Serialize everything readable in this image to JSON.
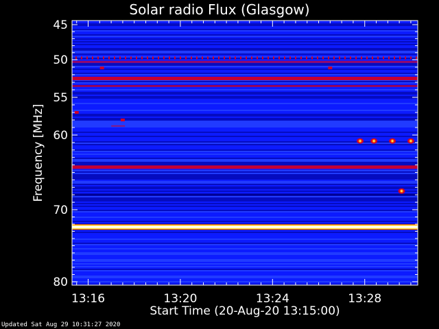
{
  "chart_data": {
    "type": "heatmap",
    "title": "Solar radio Flux (Glasgow)",
    "xlabel": "Start Time (20-Aug-20 13:15:00)",
    "ylabel": "Frequency [MHz]",
    "x_unit": "minutes after 13:15:00",
    "xlim": [
      0.3,
      15.3
    ],
    "ylim_mhz": [
      45,
      80
    ],
    "x_ticks": [
      {
        "value": 1,
        "label": "13:16"
      },
      {
        "value": 5,
        "label": "13:20"
      },
      {
        "value": 9,
        "label": "13:24"
      },
      {
        "value": 13,
        "label": "13:28"
      }
    ],
    "y_ticks": [
      {
        "value": 45,
        "label": "45"
      },
      {
        "value": 50,
        "label": "50"
      },
      {
        "value": 55,
        "label": "55"
      },
      {
        "value": 60,
        "label": "60"
      },
      {
        "value": 70,
        "label": "70"
      },
      {
        "value": 80,
        "label": "80"
      }
    ],
    "background_level": "low (blue)",
    "horizontal_bands": [
      {
        "mhz": 49.7,
        "intensity": "medium",
        "pattern": "dashed"
      },
      {
        "mhz": 50.3,
        "intensity": "low-medium"
      },
      {
        "mhz": 52.5,
        "intensity": "medium"
      },
      {
        "mhz": 53.5,
        "intensity": "low-medium"
      },
      {
        "mhz": 64.3,
        "intensity": "medium"
      },
      {
        "mhz": 72.4,
        "intensity": "very high (white/yellow)"
      },
      {
        "mhz": 68.0,
        "intensity": "low"
      }
    ],
    "bursts": [
      {
        "t_min": 0.5,
        "mhz": 57.0,
        "intensity": "medium"
      },
      {
        "t_min": 1.6,
        "mhz": 51.1,
        "intensity": "medium"
      },
      {
        "t_min": 2.5,
        "mhz": 58.0,
        "intensity": "medium"
      },
      {
        "t_min": 2.3,
        "mhz": 58.8,
        "intensity": "low"
      },
      {
        "t_min": 11.5,
        "mhz": 51.1,
        "intensity": "medium"
      },
      {
        "t_min": 12.8,
        "mhz": 60.8,
        "intensity": "high"
      },
      {
        "t_min": 13.4,
        "mhz": 60.8,
        "intensity": "high"
      },
      {
        "t_min": 14.2,
        "mhz": 60.8,
        "intensity": "high"
      },
      {
        "t_min": 15.0,
        "mhz": 60.8,
        "intensity": "high"
      },
      {
        "t_min": 14.6,
        "mhz": 67.5,
        "intensity": "high"
      }
    ],
    "colormap": [
      "#00008c",
      "#0c1cff",
      "#3355ff",
      "#d0002a",
      "#ff8000",
      "#ffff80",
      "#ffffff"
    ],
    "background_color": "#000000",
    "text_color": "#ffffff"
  },
  "footer": "Updated Sat Aug 29 10:31:27 2020"
}
